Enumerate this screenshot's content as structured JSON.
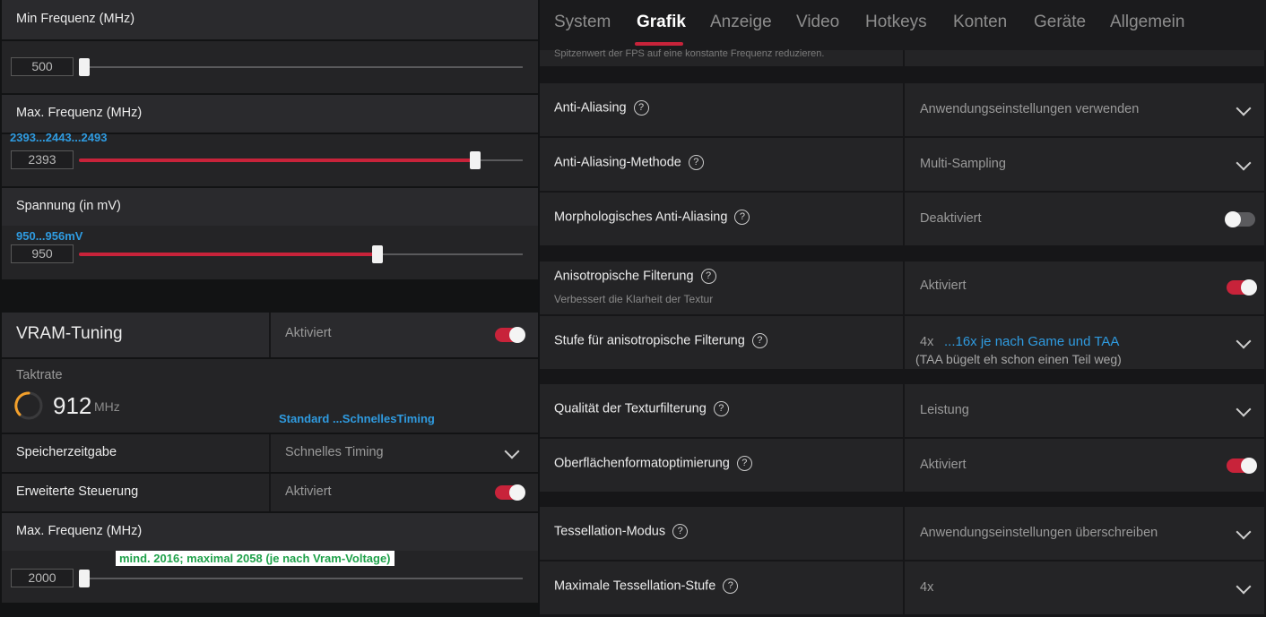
{
  "left": {
    "min_freq": {
      "label": "Min Frequenz (MHz)",
      "value": "500",
      "level": 0.0
    },
    "max_freq": {
      "label": "Max. Frequenz (MHz)",
      "annotation": "2393...2443...2493",
      "value": "2393",
      "level": 0.88
    },
    "voltage": {
      "label": "Spannung (in mV)",
      "annotation": "950...956mV",
      "value": "950",
      "level": 0.66
    },
    "vram": {
      "title": "VRAM-Tuning",
      "status": "Aktiviert",
      "clock_label": "Taktrate",
      "clock_value": "912",
      "clock_unit": "MHz",
      "annotation": "Standard ...SchnellesTiming",
      "memory_timing": {
        "label": "Speicherzeitgabe",
        "value": "Schnelles Timing"
      },
      "advanced": {
        "label": "Erweiterte Steuerung",
        "value": "Aktiviert"
      },
      "max_freq": {
        "label": "Max. Frequenz (MHz)",
        "annotation": "mind. 2016; maximal 2058 (je nach Vram-Voltage)",
        "value": "2000",
        "level": 0.0
      }
    }
  },
  "nav": {
    "tabs": [
      "System",
      "Grafik",
      "Anzeige",
      "Video",
      "Hotkeys",
      "Konten",
      "Geräte",
      "Allgemein"
    ],
    "active": "Grafik",
    "accent": "#c8233a"
  },
  "top_partial": {
    "text": "Spitzenwert der FPS auf eine konstante Frequenz reduzieren."
  },
  "settings": [
    {
      "label": "Anti-Aliasing",
      "value": "Anwendungseinstellungen verwenden"
    },
    {
      "label": "Anti-Aliasing-Methode",
      "value": "Multi-Sampling"
    },
    {
      "label": "Morphologisches Anti-Aliasing",
      "value": "Deaktiviert"
    },
    {
      "label": "Anisotropische Filterung",
      "sublabel": "Verbessert die Klarheit der Textur",
      "value": "Aktiviert"
    },
    {
      "label": "Stufe für anisotropische Filterung",
      "value": "4x",
      "annotation": "...16x je nach Game und TAA",
      "note": "(TAA bügelt eh schon einen Teil weg)"
    },
    {
      "label": "Qualität der Texturfilterung",
      "value": "Leistung"
    },
    {
      "label": "Oberflächenformatoptimierung",
      "value": "Aktiviert"
    },
    {
      "label": "Tessellation-Modus",
      "value": "Anwendungseinstellungen überschreiben"
    },
    {
      "label": "Maximale Tessellation-Stufe",
      "value": "4x"
    }
  ],
  "help_glyph": "?"
}
